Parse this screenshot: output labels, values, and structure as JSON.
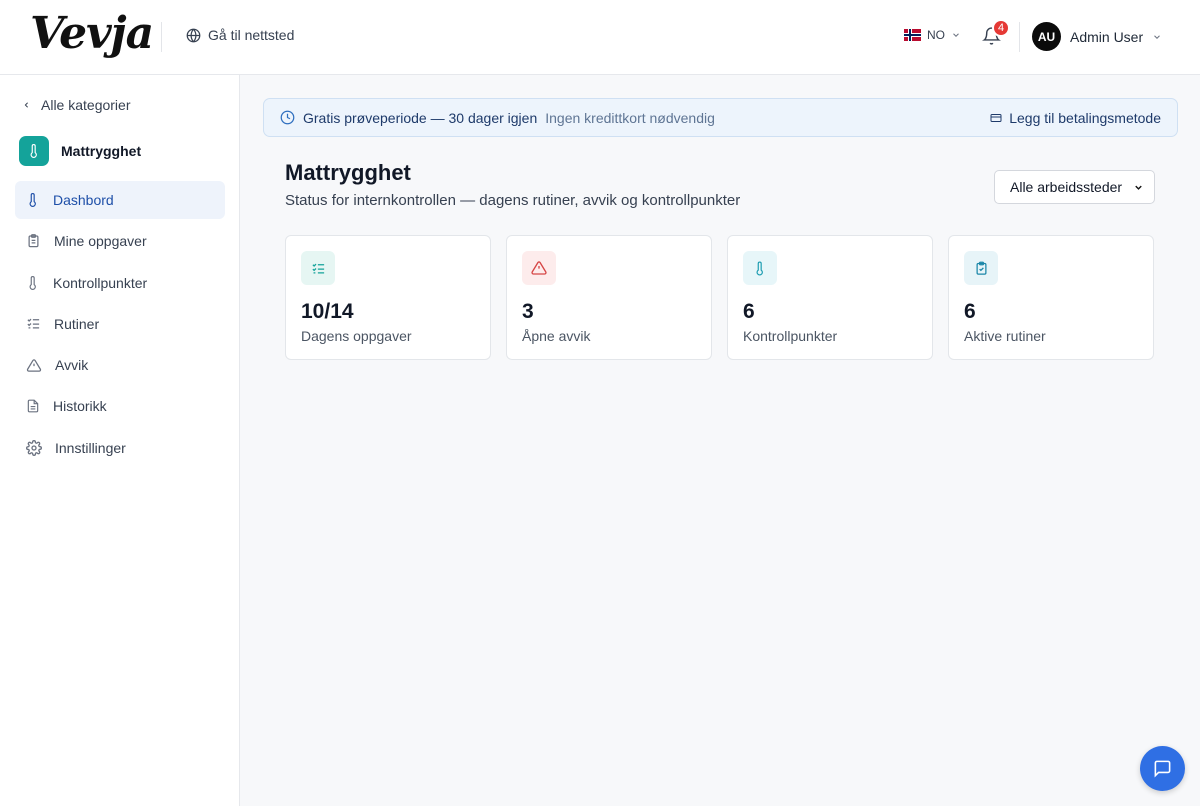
{
  "header": {
    "logo_text": "Vevja",
    "site_link_label": "Gå til nettsted",
    "language_code": "NO",
    "notification_count": "4",
    "user_initials": "AU",
    "user_name": "Admin User"
  },
  "sidebar": {
    "back_label": "Alle kategorier",
    "category_name": "Mattrygghet",
    "category_color": "#14a39a",
    "items": [
      {
        "label": "Dashbord",
        "icon": "thermometer-icon",
        "active": true
      },
      {
        "label": "Mine oppgaver",
        "icon": "clipboard-icon",
        "active": false
      },
      {
        "label": "Kontrollpunkter",
        "icon": "thermometer-icon",
        "active": false
      },
      {
        "label": "Rutiner",
        "icon": "checklist-icon",
        "active": false
      },
      {
        "label": "Avvik",
        "icon": "warning-triangle-icon",
        "active": false
      },
      {
        "label": "Historikk",
        "icon": "document-icon",
        "active": false
      },
      {
        "label": "Innstillinger",
        "icon": "gear-icon",
        "active": false
      }
    ]
  },
  "banner": {
    "title": "Gratis prøveperiode — 30 dager igjen",
    "subtitle": "Ingen kredittkort nødvendig",
    "action_label": "Legg til betalingsmetode"
  },
  "main": {
    "title": "Mattrygghet",
    "subtitle": "Status for internkontrollen — dagens rutiner, avvik og kontrollpunkter",
    "location_select": {
      "selected": "Alle arbeidssteder"
    },
    "stats": [
      {
        "value": "10/14",
        "label": "Dagens oppgaver",
        "icon": "checklist-icon",
        "color": "#14a39a"
      },
      {
        "value": "3",
        "label": "Åpne avvik",
        "icon": "warning-triangle-icon",
        "color": "#d64545"
      },
      {
        "value": "6",
        "label": "Kontrollpunkter",
        "icon": "thermometer-icon",
        "color": "#1a9bb0"
      },
      {
        "value": "6",
        "label": "Aktive rutiner",
        "icon": "clipboard-check-icon",
        "color": "#1a86a8"
      }
    ]
  },
  "chat": {
    "icon": "chat-bubble-icon"
  }
}
